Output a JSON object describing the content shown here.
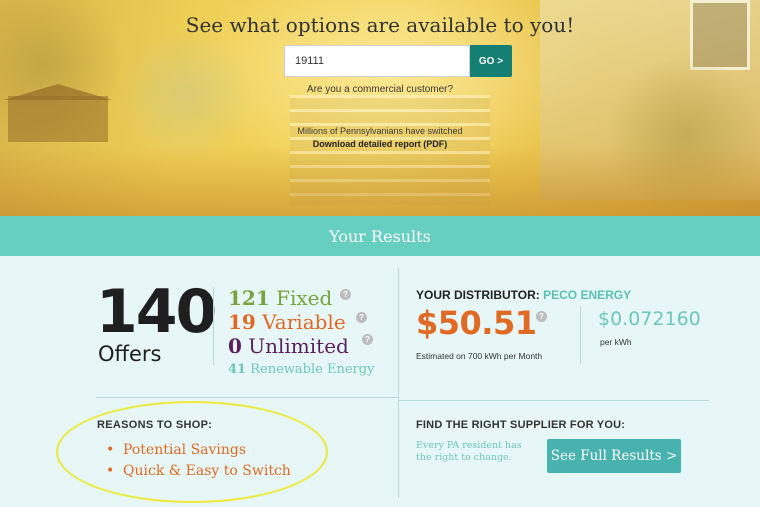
{
  "hero": {
    "title": "See what options are available to you!",
    "zip_value": "19111",
    "go_label": "GO >",
    "commercial_link": "Are you a commercial customer?",
    "switched_text": "Millions of Pennsylvanians have switched",
    "report_link": "Download detailed report (PDF)"
  },
  "results": {
    "header": "Your Results",
    "offers": {
      "count": "140",
      "label": "Offers"
    },
    "rates": {
      "fixed_count": "121",
      "fixed_label": "Fixed",
      "variable_count": "19",
      "variable_label": "Variable",
      "unlimited_count": "0",
      "unlimited_label": "Unlimited",
      "renewable_count": "41",
      "renewable_label": "Renewable Energy"
    },
    "help_glyph": "?",
    "distributor": {
      "label": "YOUR DISTRIBUTOR:",
      "name": "PECO ENERGY",
      "price": "$50.51",
      "price_note": "Estimated on 700 kWh per Month",
      "kwh_price": "$0.072160",
      "kwh_label": "per kWh"
    },
    "reasons": {
      "title": "REASONS TO SHOP:",
      "bullet": "•",
      "items": [
        "Potential Savings",
        "Quick & Easy to Switch"
      ]
    },
    "find_supplier": {
      "title": "FIND THE RIGHT SUPPLIER FOR YOU:",
      "text": "Every PA resident has the right to change.",
      "button_label": "See Full Results >"
    }
  },
  "colors": {
    "teal_bar": "#67cfc0",
    "go_button": "#167f73",
    "orange": "#e06a24",
    "green": "#77a43c",
    "purple": "#5a1f5e",
    "light_teal": "#6cc8bb",
    "highlight": "#ecea3b"
  }
}
